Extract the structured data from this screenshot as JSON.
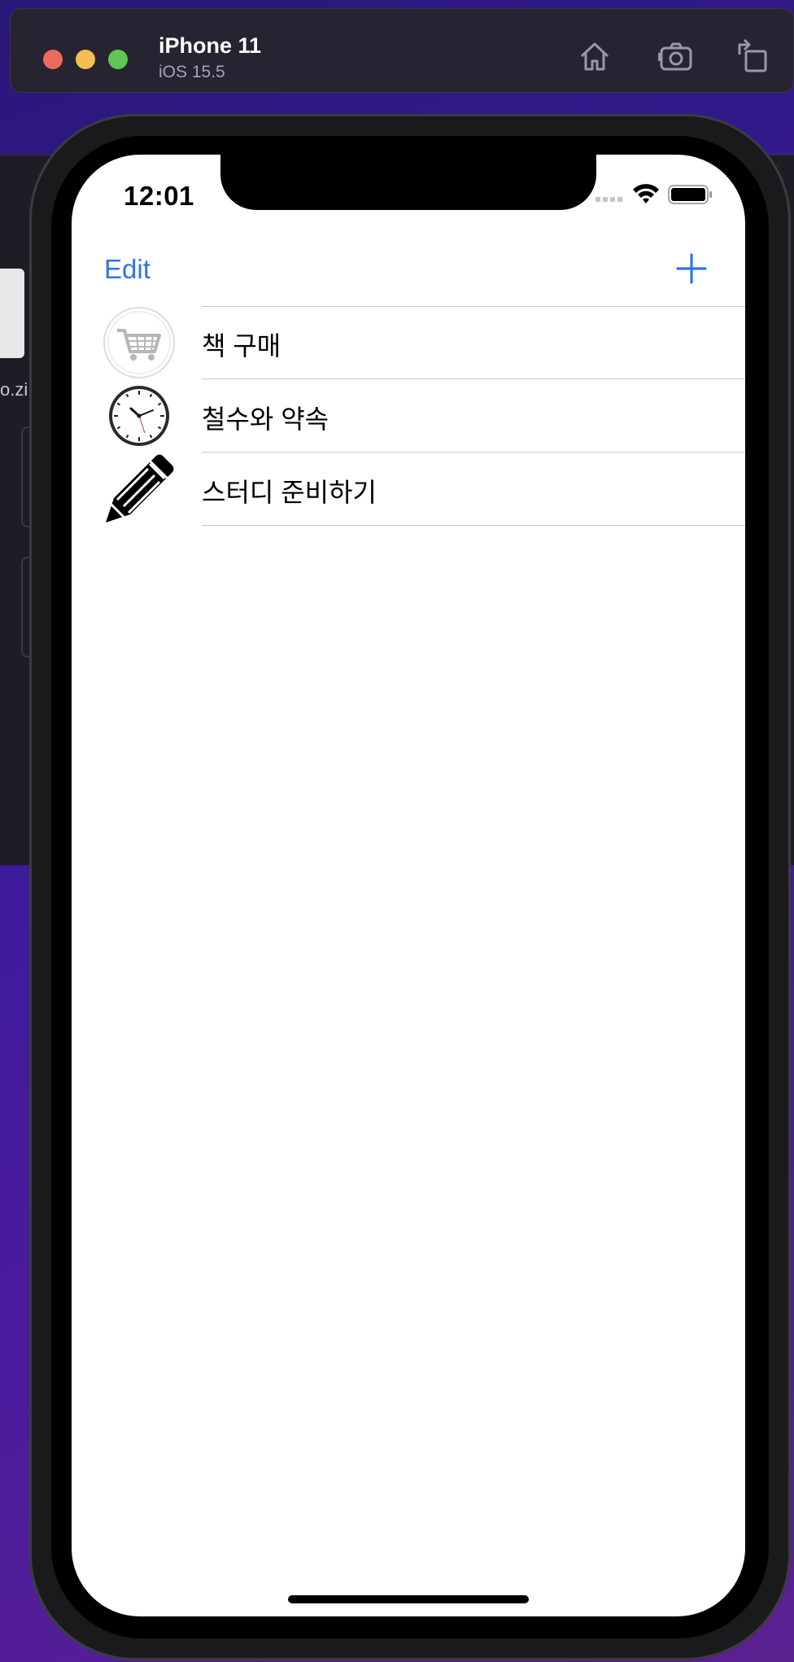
{
  "simulator": {
    "device_name": "iPhone 11",
    "os_version": "iOS 15.5",
    "buttons": [
      "home-icon",
      "screenshot-icon",
      "rotate-icon"
    ]
  },
  "background": {
    "file_label": "o.zi"
  },
  "status_bar": {
    "time": "12:01"
  },
  "nav": {
    "edit_label": "Edit",
    "add_icon": "plus-icon",
    "accent_color": "#2f74e6"
  },
  "list": {
    "items": [
      {
        "label": "책 구매",
        "icon": "cart-icon"
      },
      {
        "label": "철수와 약속",
        "icon": "clock-icon"
      },
      {
        "label": "스터디 준비하기",
        "icon": "pencil-icon"
      }
    ]
  }
}
